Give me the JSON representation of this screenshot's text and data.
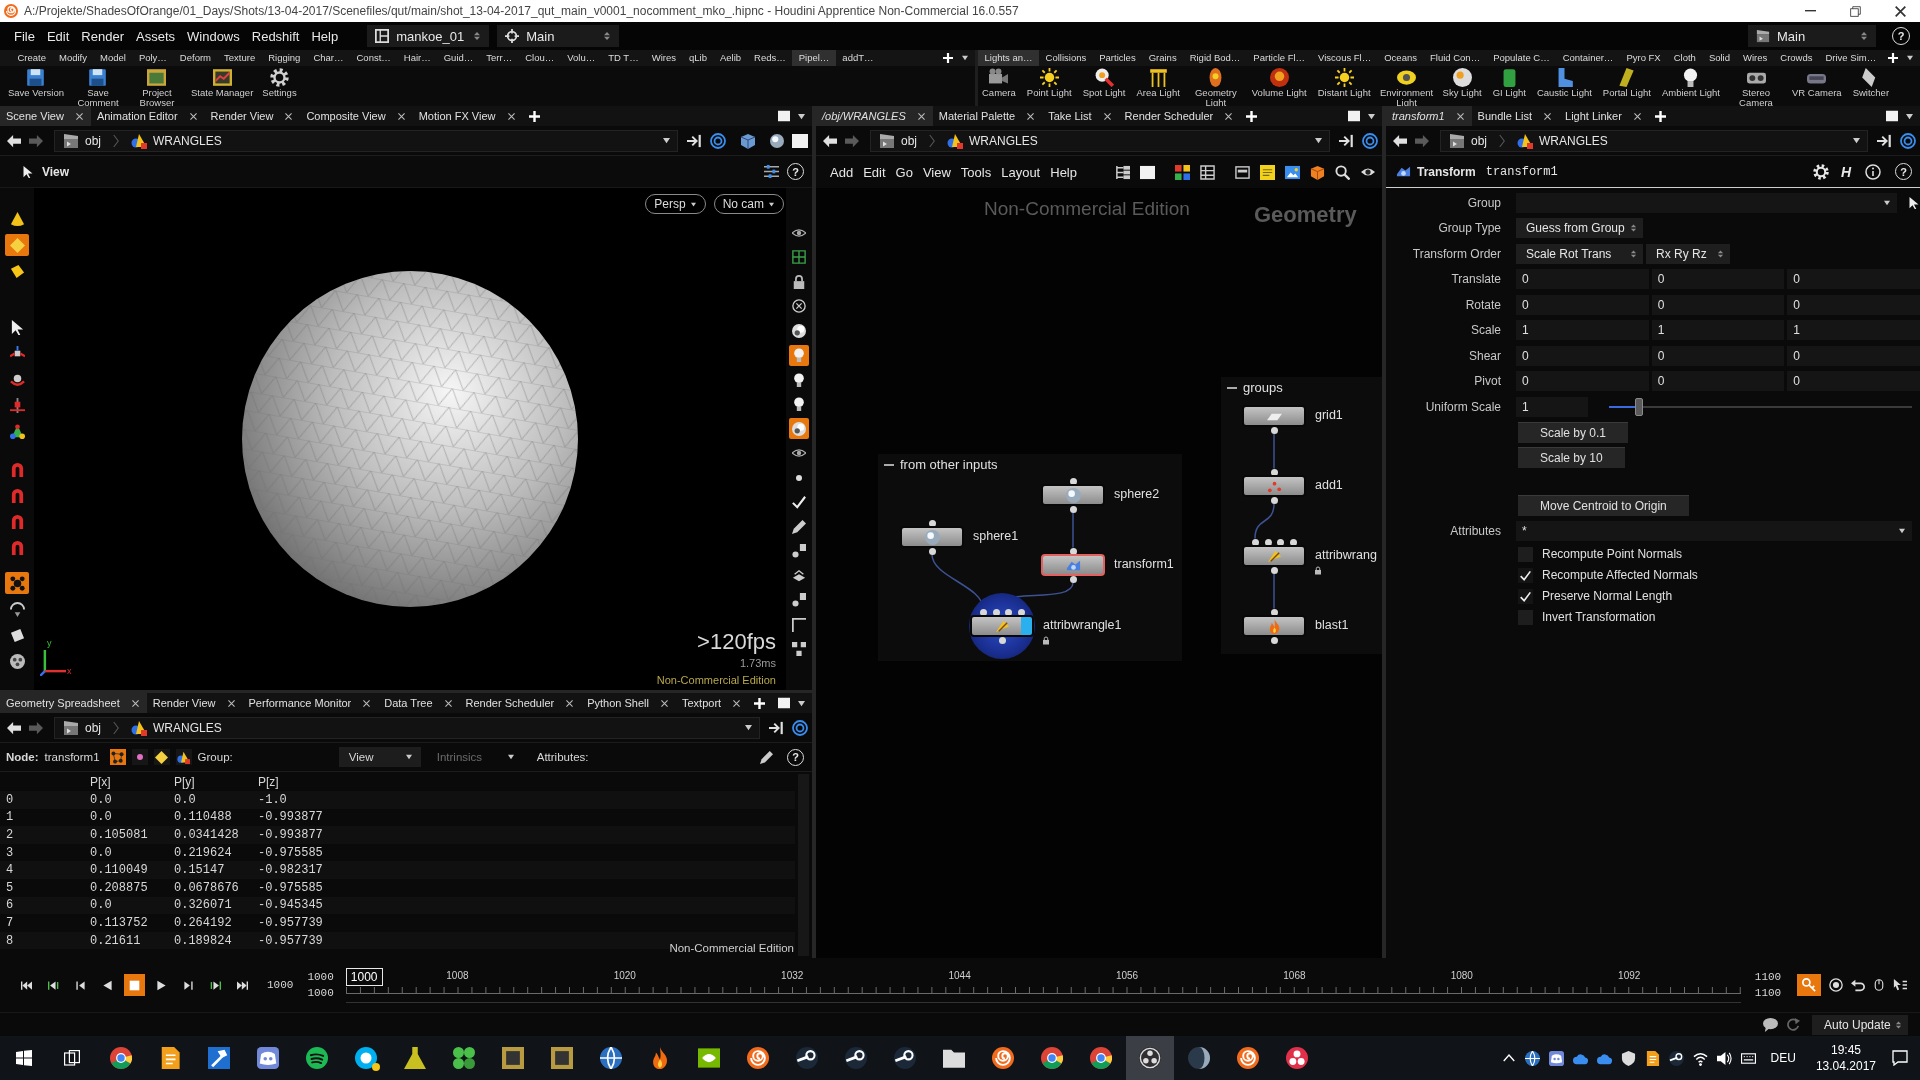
{
  "window": {
    "title": "A:/Projekte/ShadesOfOrange/01_Days/Shots/13-04-2017/Scenefiles/qut/main/shot_13-04-2017_qut_main_v0001_nocomment_mko_.hipnc - Houdini Apprentice Non-Commercial 16.0.557"
  },
  "menu_bar": {
    "menus": [
      "File",
      "Edit",
      "Render",
      "Assets",
      "Windows",
      "Redshift",
      "Help"
    ],
    "desktop": "mankoe_01",
    "context": "Main",
    "desk": "Main",
    "help_glyph": "?"
  },
  "shelves": [
    {
      "tabs": [
        {
          "label": "Create",
          "selected": false
        },
        {
          "label": "Modify",
          "selected": false
        },
        {
          "label": "Model",
          "selected": false
        },
        {
          "label": "Poly…",
          "selected": false
        },
        {
          "label": "Deform",
          "selected": false
        },
        {
          "label": "Texture",
          "selected": false
        },
        {
          "label": "Rigging",
          "selected": false
        },
        {
          "label": "Char…",
          "selected": false
        },
        {
          "label": "Const…",
          "selected": false
        },
        {
          "label": "Hair…",
          "selected": false
        },
        {
          "label": "Guid…",
          "selected": false
        },
        {
          "label": "Terr…",
          "selected": false
        },
        {
          "label": "Clou…",
          "selected": false
        },
        {
          "label": "Volu…",
          "selected": false
        },
        {
          "label": "TD T…",
          "selected": false
        },
        {
          "label": "Wires",
          "selected": false
        },
        {
          "label": "qLib",
          "selected": false
        },
        {
          "label": "Aelib",
          "selected": false
        },
        {
          "label": "Reds…",
          "selected": false
        },
        {
          "label": "Pipel…",
          "selected": true
        },
        {
          "label": "addT…",
          "selected": false
        }
      ],
      "tools": [
        "Save Version",
        "Save Comment",
        "Project Browser",
        "State Manager",
        "Settings"
      ]
    },
    {
      "tabs": [
        {
          "label": "Lights an…",
          "selected": true
        },
        {
          "label": "Collisions",
          "selected": false
        },
        {
          "label": "Particles",
          "selected": false
        },
        {
          "label": "Grains",
          "selected": false
        },
        {
          "label": "Rigid Bod…",
          "selected": false
        },
        {
          "label": "Particle Fl…",
          "selected": false
        },
        {
          "label": "Viscous Fl…",
          "selected": false
        },
        {
          "label": "Oceans",
          "selected": false
        },
        {
          "label": "Fluid Con…",
          "selected": false
        },
        {
          "label": "Populate C…",
          "selected": false
        },
        {
          "label": "Container…",
          "selected": false
        },
        {
          "label": "Pyro FX",
          "selected": false
        },
        {
          "label": "Cloth",
          "selected": false
        },
        {
          "label": "Solid",
          "selected": false
        },
        {
          "label": "Wires",
          "selected": false
        },
        {
          "label": "Crowds",
          "selected": false
        },
        {
          "label": "Drive Sim…",
          "selected": false
        }
      ],
      "tools": [
        "Camera",
        "Point Light",
        "Spot Light",
        "Area Light",
        "Geometry Light",
        "Volume Light",
        "Distant Light",
        "Environment Light",
        "Sky Light",
        "GI Light",
        "Caustic Light",
        "Portal Light",
        "Ambient Light",
        "Stereo Camera",
        "VR Camera",
        "Switcher"
      ]
    }
  ],
  "scene_view": {
    "tabs": [
      {
        "label": "Scene View",
        "selected": true
      },
      {
        "label": "Animation Editor",
        "selected": false
      },
      {
        "label": "Render View",
        "selected": false
      },
      {
        "label": "Composite View",
        "selected": false
      },
      {
        "label": "Motion FX View",
        "selected": false
      }
    ],
    "path": [
      "obj",
      "WRANGLES"
    ],
    "view_menu": "View",
    "help_glyph": "?",
    "camera_menu": "Persp",
    "camera_name": "No cam",
    "fps": ">120fps",
    "frame_time": "1.73ms",
    "edition": "Non-Commercial Edition",
    "axis_labels": [
      "y",
      "x"
    ],
    "left_tools": [
      {
        "selected": false
      },
      {
        "selected": true
      },
      {
        "selected": false
      },
      {
        "selected": false
      },
      {
        "selected": false
      },
      {
        "selected": false
      },
      {
        "selected": false
      },
      {
        "selected": false
      },
      {
        "selected": false
      },
      {
        "selected": false
      },
      {
        "selected": false
      },
      {
        "selected": false
      },
      {
        "selected": true
      },
      {
        "selected": false
      },
      {
        "selected": false
      },
      {
        "selected": false
      }
    ],
    "right_tools": [
      {
        "selected": false
      },
      {
        "selected": false
      },
      {
        "selected": false
      },
      {
        "selected": false
      },
      {
        "selected": false
      },
      {
        "selected": true
      },
      {
        "selected": false
      },
      {
        "selected": false
      },
      {
        "selected": true
      },
      {
        "selected": false
      },
      {
        "selected": false
      },
      {
        "selected": false
      },
      {
        "selected": false
      },
      {
        "selected": false
      },
      {
        "selected": false
      },
      {
        "selected": false
      },
      {
        "selected": false
      },
      {
        "selected": false
      }
    ]
  },
  "spreadsheet": {
    "tabs": [
      {
        "label": "Geometry Spreadsheet",
        "selected": true
      },
      {
        "label": "Render View",
        "selected": false
      },
      {
        "label": "Performance Monitor",
        "selected": false
      },
      {
        "label": "Data Tree",
        "selected": false
      },
      {
        "label": "Render Scheduler",
        "selected": false
      },
      {
        "label": "Python Shell",
        "selected": false
      },
      {
        "label": "Textport",
        "selected": false
      }
    ],
    "path": [
      "obj",
      "WRANGLES"
    ],
    "node_label": "Node:",
    "node": "transform1",
    "classes": [
      {
        "selected": true
      },
      {
        "selected": false
      },
      {
        "selected": false
      },
      {
        "selected": false
      }
    ],
    "group_label": "Group:",
    "view_menu": "View",
    "intrinsics": {
      "label": "Intrinsics",
      "disabled": true
    },
    "attributes_label": "Attributes:",
    "help_glyph": "?",
    "columns": [
      "P[x]",
      "P[y]",
      "P[z]"
    ],
    "rows": [
      {
        "index": "0",
        "cells": [
          "0.0",
          "0.0",
          "-1.0"
        ]
      },
      {
        "index": "1",
        "cells": [
          "0.0",
          "0.110488",
          "-0.993877"
        ]
      },
      {
        "index": "2",
        "cells": [
          "0.105081",
          "0.0341428",
          "-0.993877"
        ]
      },
      {
        "index": "3",
        "cells": [
          "0.0",
          "0.219624",
          "-0.975585"
        ]
      },
      {
        "index": "4",
        "cells": [
          "0.110049",
          "0.15147",
          "-0.982317"
        ]
      },
      {
        "index": "5",
        "cells": [
          "0.208875",
          "0.0678676",
          "-0.975585"
        ]
      },
      {
        "index": "6",
        "cells": [
          "0.0",
          "0.326071",
          "-0.945345"
        ]
      },
      {
        "index": "7",
        "cells": [
          "0.113752",
          "0.264192",
          "-0.957739"
        ]
      },
      {
        "index": "8",
        "cells": [
          "0.21611",
          "0.189824",
          "-0.957739"
        ]
      }
    ],
    "edition": "Non-Commercial Edition"
  },
  "network": {
    "tabs": [
      {
        "label": "/obj/WRANGLES",
        "selected": true
      },
      {
        "label": "Material Palette",
        "selected": false
      },
      {
        "label": "Take List",
        "selected": false
      },
      {
        "label": "Render Scheduler",
        "selected": false
      }
    ],
    "path": [
      "obj",
      "WRANGLES"
    ],
    "menus": [
      "Add",
      "Edit",
      "Go",
      "View",
      "Tools",
      "Layout",
      "Help"
    ],
    "edition": "Non-Commercial Edition",
    "context": "Geometry",
    "boxes": [
      {
        "label": "from other inputs",
        "nodes": [
          {
            "name": "sphere2",
            "kind": "sphere",
            "selected": false,
            "display": false
          },
          {
            "name": "sphere1",
            "kind": "sphere",
            "selected": false,
            "display": false
          },
          {
            "name": "transform1",
            "kind": "transform",
            "selected": true,
            "display": false
          },
          {
            "name": "attribwrangle1",
            "kind": "wrangle",
            "selected": false,
            "display": true
          }
        ]
      },
      {
        "label": "groups",
        "nodes": [
          {
            "name": "grid1",
            "kind": "grid",
            "selected": false,
            "display": false
          },
          {
            "name": "add1",
            "kind": "add",
            "selected": false,
            "display": false
          },
          {
            "name": "attribwrang",
            "kind": "wrangle",
            "selected": false,
            "display": false
          },
          {
            "name": "blast1",
            "kind": "blast",
            "selected": false,
            "display": false
          }
        ]
      }
    ]
  },
  "parameters": {
    "tabs": [
      {
        "label": "transform1",
        "selected": true
      },
      {
        "label": "Bundle List",
        "selected": false
      },
      {
        "label": "Light Linker",
        "selected": false
      }
    ],
    "path": [
      "obj",
      "WRANGLES"
    ],
    "node_type": "Transform",
    "node_name": "transform1",
    "header_glyph": "H",
    "help_glyph": "?",
    "rows": [
      {
        "kind": "field",
        "label": "Group"
      },
      {
        "kind": "menu",
        "label": "Group Type",
        "values": [
          "Guess from Group"
        ]
      },
      {
        "kind": "menu",
        "label": "Transform Order",
        "values": [
          "Scale Rot Trans",
          "Rx Ry Rz"
        ]
      },
      {
        "kind": "vector",
        "label": "Translate",
        "values": [
          "0",
          "0",
          "0"
        ]
      },
      {
        "kind": "vector",
        "label": "Rotate",
        "values": [
          "0",
          "0",
          "0"
        ]
      },
      {
        "kind": "vector",
        "label": "Scale",
        "values": [
          "1",
          "1",
          "1"
        ]
      },
      {
        "kind": "vector",
        "label": "Shear",
        "values": [
          "0",
          "0",
          "0"
        ]
      },
      {
        "kind": "vector",
        "label": "Pivot",
        "values": [
          "0",
          "0",
          "0"
        ]
      },
      {
        "kind": "slider",
        "label": "Uniform Scale",
        "value": "1",
        "level": 0.1
      },
      {
        "kind": "button",
        "label": "Scale by 0.1"
      },
      {
        "kind": "button",
        "label": "Scale by 10"
      },
      {
        "kind": "button",
        "label": "Move Centroid to Origin"
      },
      {
        "kind": "field",
        "label": "Attributes",
        "value": "*"
      },
      {
        "kind": "toggle",
        "label": "Recompute Point Normals",
        "checked": false
      },
      {
        "kind": "toggle",
        "label": "Recompute Affected Normals",
        "checked": true
      },
      {
        "kind": "toggle",
        "label": "Preserve Normal Length",
        "checked": true
      },
      {
        "kind": "toggle",
        "label": "Invert Transformation",
        "checked": false
      }
    ]
  },
  "timeline": {
    "transport": [
      {
        "selected": false
      },
      {
        "selected": false
      },
      {
        "selected": false
      },
      {
        "selected": false
      },
      {
        "selected": true
      },
      {
        "selected": false
      },
      {
        "selected": false
      },
      {
        "selected": false
      },
      {
        "selected": false
      }
    ],
    "current_frame": "1000",
    "range_start": [
      "1000",
      "1000"
    ],
    "marker": "1000",
    "level": 0,
    "ticks": [
      "1008",
      "1020",
      "1032",
      "1044",
      "1056",
      "1068",
      "1080",
      "1092"
    ],
    "range_end": [
      "1100",
      "1100"
    ]
  },
  "update_bar": {
    "mode": "Auto Update"
  },
  "taskbar": {
    "apps": [
      {
        "selected": false,
        "badge": false
      },
      {
        "selected": false,
        "badge": false
      },
      {
        "selected": false,
        "badge": false
      },
      {
        "selected": false,
        "badge": false
      },
      {
        "selected": false,
        "badge": false
      },
      {
        "selected": false,
        "badge": true
      },
      {
        "selected": false,
        "badge": false
      },
      {
        "selected": false,
        "badge": false
      },
      {
        "selected": false,
        "badge": false
      },
      {
        "selected": false,
        "badge": false
      },
      {
        "selected": false,
        "badge": false
      },
      {
        "selected": false,
        "badge": false
      },
      {
        "selected": false,
        "badge": false
      },
      {
        "selected": false,
        "badge": false
      },
      {
        "selected": false,
        "badge": false
      },
      {
        "selected": false,
        "badge": false
      },
      {
        "selected": false,
        "badge": false
      },
      {
        "selected": false,
        "badge": false
      },
      {
        "selected": false,
        "badge": false
      },
      {
        "selected": false,
        "badge": false
      },
      {
        "selected": false,
        "badge": false
      },
      {
        "selected": true,
        "badge": false
      },
      {
        "selected": false,
        "badge": false
      },
      {
        "selected": false,
        "badge": false
      },
      {
        "selected": false,
        "badge": false
      }
    ],
    "language": "DEU",
    "time": "19:45",
    "date": "13.04.2017"
  }
}
